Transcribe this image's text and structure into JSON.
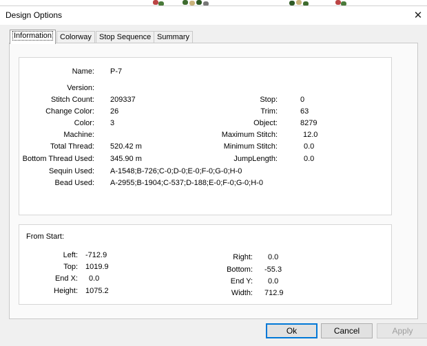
{
  "window": {
    "title": "Design Options"
  },
  "tabs": [
    {
      "label": "Information",
      "active": true
    },
    {
      "label": "Colorway",
      "active": false
    },
    {
      "label": "Stop Sequence",
      "active": false
    },
    {
      "label": "Summary",
      "active": false
    }
  ],
  "info": {
    "name": {
      "label": "Name:",
      "value": "P-7"
    },
    "version": {
      "label": "Version:",
      "value": ""
    },
    "stitch_count": {
      "label": "Stitch Count:",
      "value": "209337"
    },
    "change_color": {
      "label": "Change Color:",
      "value": "26"
    },
    "color": {
      "label": "Color:",
      "value": "3"
    },
    "machine": {
      "label": "Machine:",
      "value": ""
    },
    "total_thread": {
      "label": "Total Thread:",
      "value": "520.42 m"
    },
    "bottom_thread": {
      "label": "Bottom Thread Used:",
      "value": "345.90 m"
    },
    "sequin_used": {
      "label": "Sequin Used:",
      "value": "A-1548;B-726;C-0;D-0;E-0;F-0;G-0;H-0"
    },
    "bead_used": {
      "label": "Bead Used:",
      "value": "A-2955;B-1904;C-537;D-188;E-0;F-0;G-0;H-0"
    },
    "stop": {
      "label": "Stop:",
      "value": "0"
    },
    "trim": {
      "label": "Trim:",
      "value": "63"
    },
    "object": {
      "label": "Object:",
      "value": "8279"
    },
    "max_stitch": {
      "label": "Maximum Stitch:",
      "value": "12.0"
    },
    "min_stitch": {
      "label": "Minimum Stitch:",
      "value": "0.0"
    },
    "jump_length": {
      "label": "JumpLength:",
      "value": "0.0"
    }
  },
  "from_start": {
    "heading": "From Start:",
    "left": {
      "label": "Left:",
      "value": "-712.9"
    },
    "top": {
      "label": "Top:",
      "value": "1019.9"
    },
    "end_x": {
      "label": "End X:",
      "value": "0.0"
    },
    "height": {
      "label": "Height:",
      "value": "1075.2"
    },
    "right": {
      "label": "Right:",
      "value": "0.0"
    },
    "bottom": {
      "label": "Bottom:",
      "value": "-55.3"
    },
    "end_y": {
      "label": "End Y:",
      "value": "0.0"
    },
    "width": {
      "label": "Width:",
      "value": "712.9"
    }
  },
  "buttons": {
    "ok": "Ok",
    "cancel": "Cancel",
    "apply": "Apply"
  }
}
